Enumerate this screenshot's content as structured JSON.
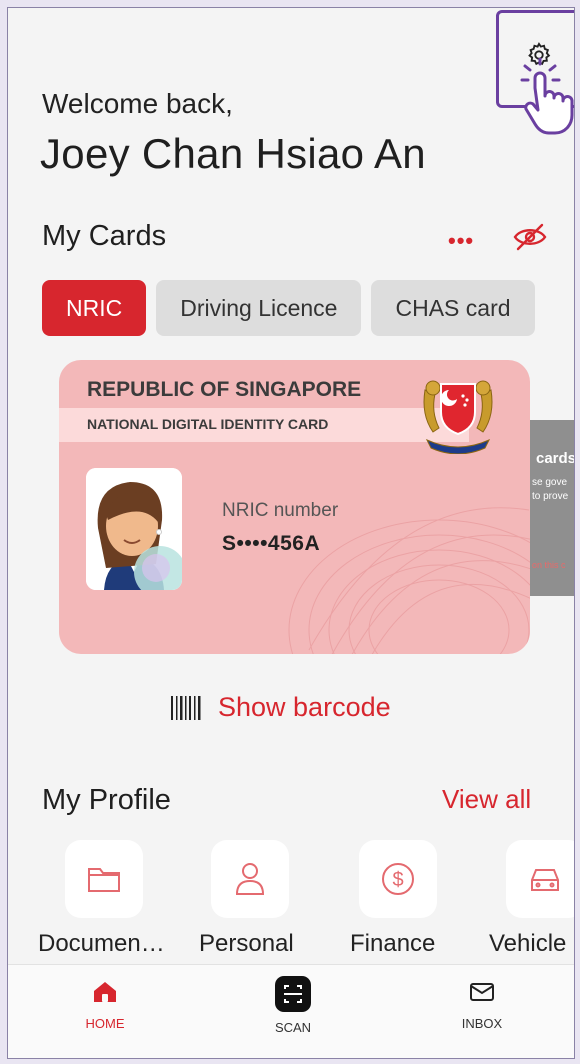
{
  "header": {
    "welcome": "Welcome back,",
    "user_name": "Joey Chan Hsiao An"
  },
  "cards_section": {
    "title": "My Cards",
    "more_icon": "more-dots-icon",
    "visibility_icon": "eye-off-icon",
    "tabs": [
      {
        "label": "NRIC",
        "active": true
      },
      {
        "label": "Driving Licence",
        "active": false
      },
      {
        "label": "CHAS card",
        "active": false
      }
    ]
  },
  "id_card": {
    "country": "REPUBLIC OF SINGAPORE",
    "card_type": "NATIONAL DIGITAL IDENTITY CARD",
    "number_label": "NRIC number",
    "number_value": "S••••456A"
  },
  "next_card": {
    "title": "cards",
    "line1": "se gove",
    "line2": "to prove",
    "line3": "on this c"
  },
  "barcode": {
    "label": "Show barcode",
    "icon": "barcode-icon"
  },
  "profile_section": {
    "title": "My Profile",
    "view_all": "View all",
    "items": [
      {
        "label": "Documen…",
        "icon": "folder-icon"
      },
      {
        "label": "Personal",
        "icon": "person-icon"
      },
      {
        "label": "Finance",
        "icon": "dollar-icon"
      },
      {
        "label": "Vehicle",
        "icon": "car-icon"
      }
    ]
  },
  "bottom_nav": {
    "items": [
      {
        "label": "HOME",
        "icon": "home-icon",
        "active": true
      },
      {
        "label": "SCAN",
        "icon": "scan-icon",
        "active": false
      },
      {
        "label": "INBOX",
        "icon": "mail-icon",
        "active": false
      }
    ]
  },
  "colors": {
    "accent": "#d7262e",
    "card": "#f3b8b9",
    "highlight_border": "#6a3fa0"
  }
}
